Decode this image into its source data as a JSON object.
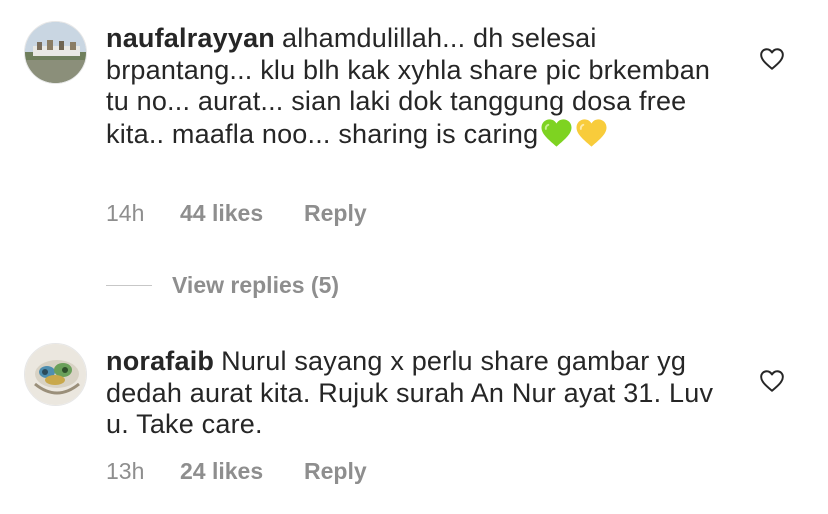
{
  "comments": [
    {
      "username": "naufalrayyan",
      "text": "alhamdulillah... dh selesai brpantang... klu blh kak xyhla share pic brkemban tu no... aurat... sian laki dok tanggung dosa free kita.. maafla noo... sharing is caring",
      "emojis": [
        "green-heart",
        "yellow-heart"
      ],
      "time": "14h",
      "likes": "44 likes",
      "reply_label": "Reply"
    },
    {
      "username": "norafaib",
      "text": "Nurul sayang x perlu share gambar yg dedah aurat kita. Rujuk surah An Nur ayat 31. Luv u. Take care.",
      "time": "13h",
      "likes": "24 likes",
      "reply_label": "Reply"
    }
  ],
  "view_replies": "View replies (5)",
  "colors": {
    "text": "#262626",
    "muted": "#8e8e8e",
    "green_heart": "#7ed321",
    "yellow_heart": "#f8cc3b"
  }
}
